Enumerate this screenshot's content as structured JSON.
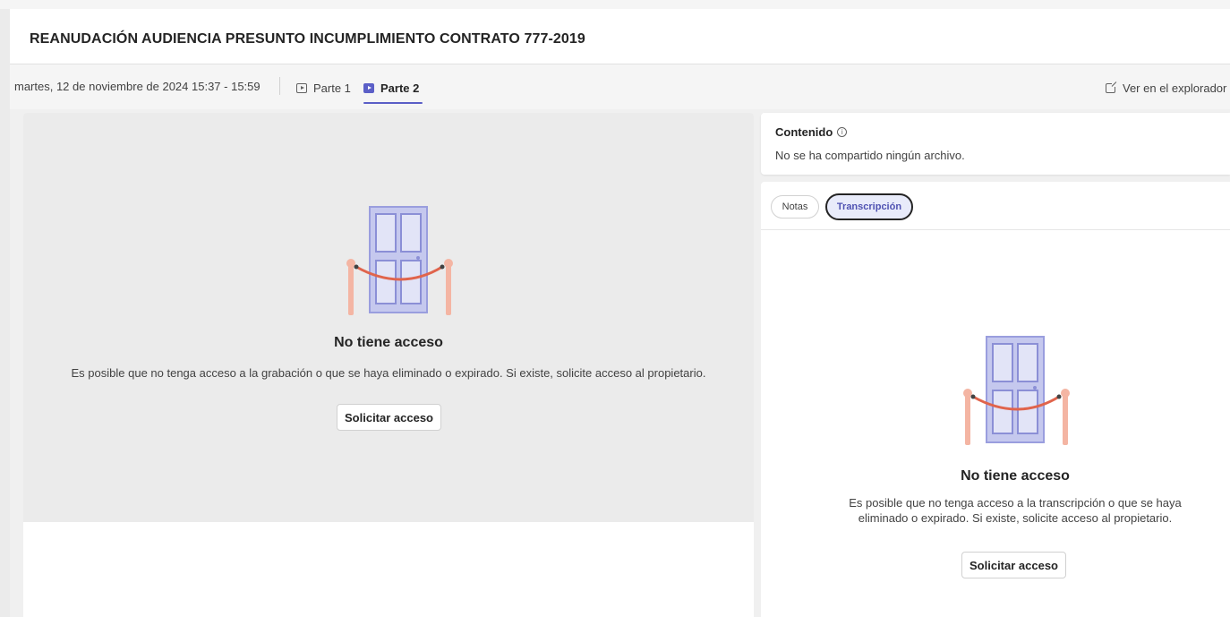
{
  "header": {
    "title": "REANUDACIÓN AUDIENCIA PRESUNTO INCUMPLIMIENTO CONTRATO 777-2019"
  },
  "subbar": {
    "datetime": "martes, 12 de noviembre de 2024 15:37 - 15:59",
    "tabs": [
      {
        "label": "Parte 1",
        "icon": "play-icon",
        "active": false
      },
      {
        "label": "Parte 2",
        "icon": "play-icon",
        "active": true
      }
    ],
    "explorer_label": "Ver en el explorador",
    "explorer_icon": "open-external-icon"
  },
  "video": {
    "heading": "No tiene acceso",
    "message": "Es posible que no tenga acceso a la grabación o que se haya eliminado o expirado. Si existe, solicite acceso al propietario.",
    "button": "Solicitar acceso",
    "illustration": "locked-door-illustration"
  },
  "content": {
    "title": "Contenido",
    "info_icon": "info-icon",
    "empty_text": "No se ha compartido ningún archivo."
  },
  "notes": {
    "tabs": [
      {
        "label": "Notas",
        "active": false
      },
      {
        "label": "Transcripción",
        "active": true
      }
    ],
    "heading": "No tiene acceso",
    "message_line1": "Es posible que no tenga acceso a la transcripción o que se haya",
    "message_line2": "eliminado o expirado. Si existe, solicite acceso al propietario.",
    "button": "Solicitar acceso",
    "illustration": "locked-door-illustration"
  },
  "colors": {
    "accent": "#5b5fc7",
    "door_fill": "#c5c8ee",
    "door_stroke": "#8b8fd6",
    "rope": "#e0644c",
    "post": "#f4b5a3"
  }
}
